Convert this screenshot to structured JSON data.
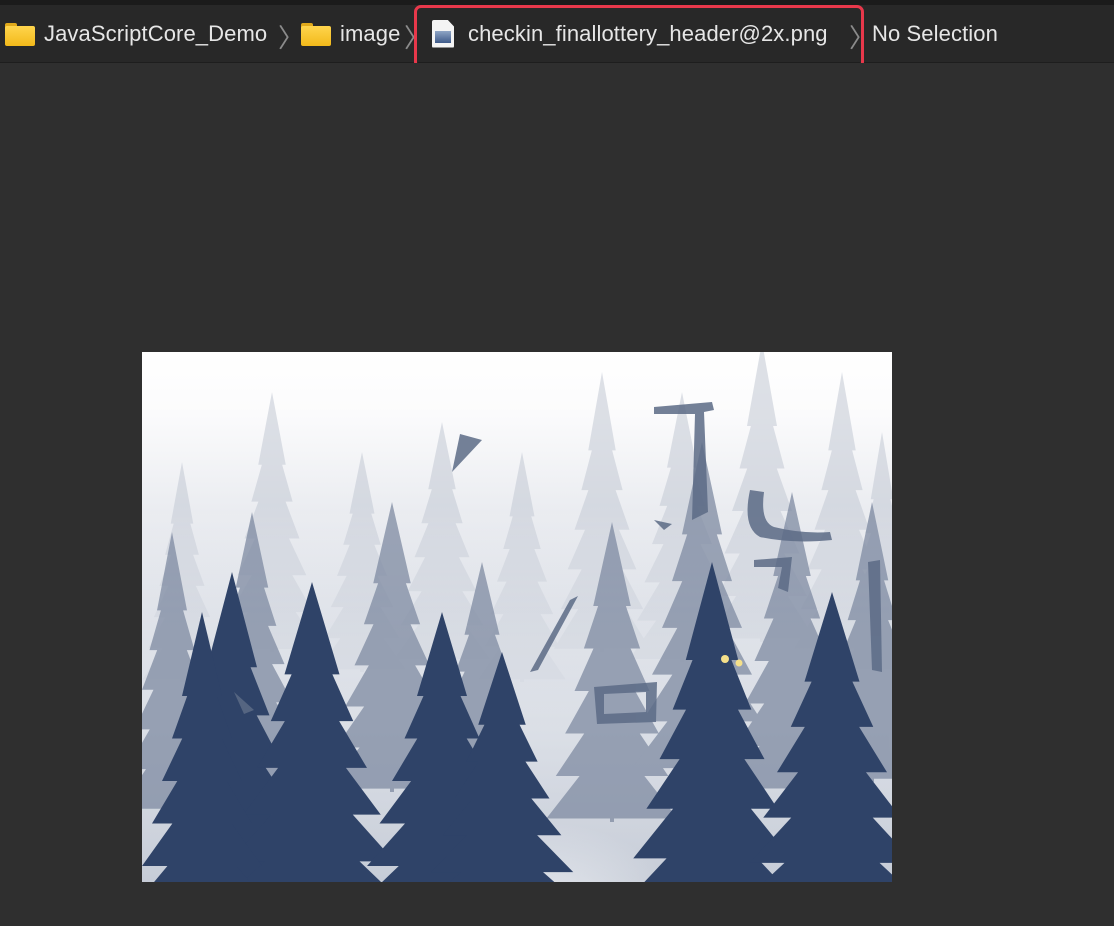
{
  "jumpbar": {
    "crumbs": [
      {
        "label": "JavaScriptCore_Demo",
        "icon": "folder-icon"
      },
      {
        "label": "image",
        "icon": "folder-icon"
      },
      {
        "label": "checkin_finallottery_header@2x.png",
        "icon": "png-file-icon"
      },
      {
        "label": "No Selection"
      }
    ],
    "separator": "〉"
  },
  "annotation": {
    "highlight_color": "#e8384b"
  },
  "colors": {
    "editor_background": "#2f2f2f",
    "jumpbar_background": "#282828",
    "tree_dark": "#2f4368",
    "tree_mid": "#7f8ba2",
    "tree_light": "#c3c9d4"
  }
}
